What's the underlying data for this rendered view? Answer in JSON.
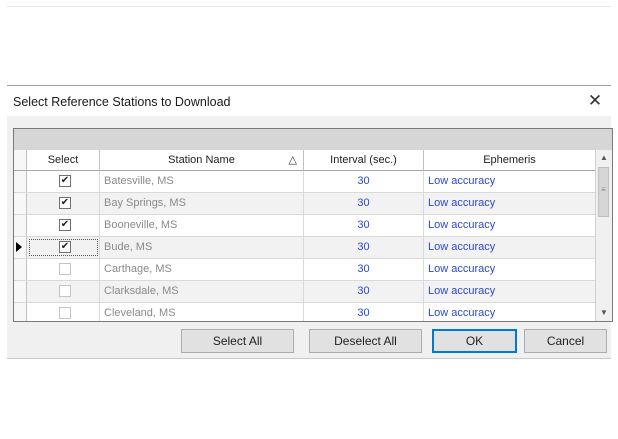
{
  "dialog": {
    "title": "Select Reference Stations to Download",
    "close_icon": "close-icon"
  },
  "grid": {
    "columns": [
      "Select",
      "Station Name",
      "Interval (sec.)",
      "Ephemeris"
    ],
    "sort_indicator": "△",
    "rows": [
      {
        "selected": true,
        "station": "Batesville, MS",
        "interval": "30",
        "ephemeris": "Low accuracy"
      },
      {
        "selected": true,
        "station": "Bay Springs, MS",
        "interval": "30",
        "ephemeris": "Low accuracy"
      },
      {
        "selected": true,
        "station": "Booneville, MS",
        "interval": "30",
        "ephemeris": "Low accuracy"
      },
      {
        "selected": true,
        "station": "Bude, MS",
        "interval": "30",
        "ephemeris": "Low accuracy",
        "current": true
      },
      {
        "selected": false,
        "station": "Carthage, MS",
        "interval": "30",
        "ephemeris": "Low accuracy"
      },
      {
        "selected": false,
        "station": "Clarksdale, MS",
        "interval": "30",
        "ephemeris": "Low accuracy"
      },
      {
        "selected": false,
        "station": "Cleveland, MS",
        "interval": "30",
        "ephemeris": "Low accuracy"
      }
    ],
    "scrollbar": {
      "up_icon": "▲",
      "down_icon": "▼",
      "grip": "≡"
    },
    "row_pointer_icon": "current-row-arrow-icon"
  },
  "buttons": {
    "select_all": "Select All",
    "deselect_all": "Deselect All",
    "ok": "OK",
    "cancel": "Cancel"
  },
  "colors": {
    "link_blue": "#2c47d6",
    "muted_text": "#8a8a8a",
    "focus_border": "#0078d7"
  },
  "checkmark": "✔"
}
